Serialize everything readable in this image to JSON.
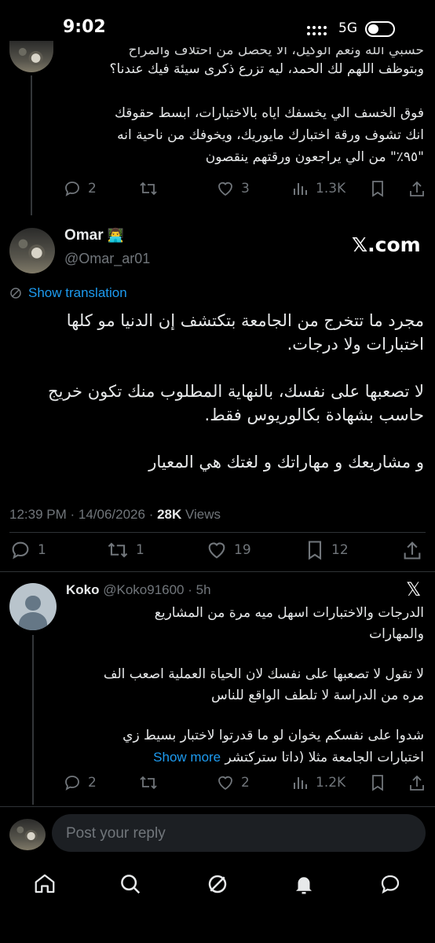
{
  "status": {
    "time": "9:02",
    "network": "5G"
  },
  "prev_tweet": {
    "line1": "حسبي الله ونعم الوكيل، الا يحصل من احتلاف والمراح",
    "line2": "وبتوظف اللهم لك الحمد، ليه تزرع ذكرى سيئة فيك عندنا؟",
    "para2": [
      "فوق الخسف الي يخسفك اياه بالاختبارات، ابسط حقوقك",
      "انك تشوف ورقة اختبارك مايوريك، ويخوفك من ناحية انه",
      "\"٩٥٪\" من الي يراجعون ورقتهم ينقصون"
    ],
    "replies": "2",
    "retweets": "",
    "likes": "3",
    "views": "1.3K"
  },
  "main_tweet": {
    "name": "Omar",
    "name_emoji": "👨‍💻",
    "handle": "@Omar_ar01",
    "watermark": "𝕏.com",
    "show_translation": "Show translation",
    "paragraphs": [
      [
        "مجرد ما تتخرج من الجامعة بتكتشف إن الدنيا مو كلها",
        "اختبارات ولا درجات."
      ],
      [
        "لا تصعبها على نفسك، بالنهاية المطلوب منك تكون خريج",
        "حاسب بشهادة بكالوريوس فقط."
      ],
      [
        "و مشاريعك و مهاراتك و لغتك هي المعيار"
      ]
    ],
    "time": "12:39 PM",
    "date": "14/06/2026",
    "views_count": "28K",
    "views_label": "Views",
    "replies": "1",
    "retweets": "1",
    "likes": "19",
    "bookmarks": "12"
  },
  "reply": {
    "name": "Koko",
    "handle": "@Koko91600",
    "age": "5h",
    "paragraphs": [
      [
        "الدرجات والاختبارات اسهل ميه مرة من المشاريع",
        "والمهارات"
      ],
      [
        "لا تقول لا تصعبها على نفسك لان الحياة العملية اصعب الف",
        "مره من الدراسة لا تلطف الواقع للناس"
      ],
      [
        "شدوا على نفسكم يخوان لو ما قدرتوا لاختبار بسيط زي"
      ]
    ],
    "last_line": "اختبارات الجامعة مثلا (داتا ستركتشر",
    "show_more": "Show more",
    "replies": "2",
    "retweets": "",
    "likes": "2",
    "views": "1.2K"
  },
  "composer": {
    "placeholder": "Post your reply"
  }
}
